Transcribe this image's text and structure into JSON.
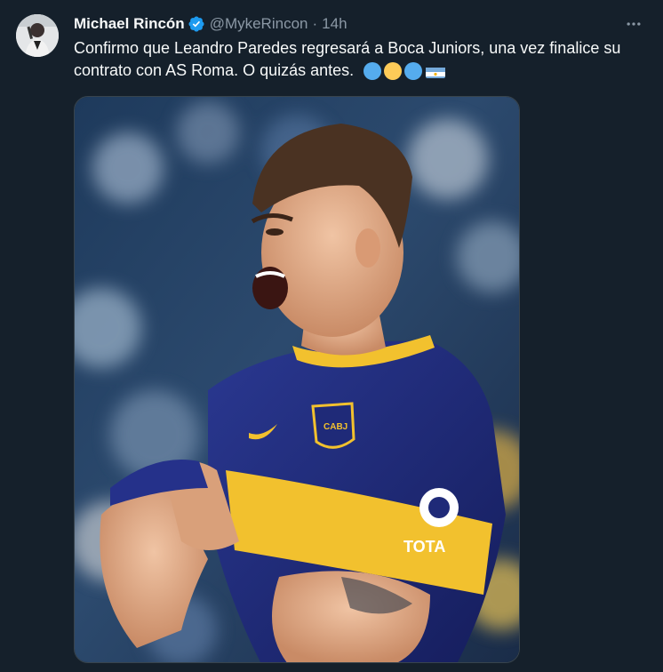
{
  "tweet": {
    "author": {
      "name": "Michael Rincón",
      "handle": "@MykeRincon",
      "verified": true,
      "avatar_icon": "profile-photo"
    },
    "separator": "·",
    "time": "14h",
    "more_icon": "more-horizontal-icon",
    "text": "Confirmo que Leandro Paredes regresará a Boca Juniors, una vez finalice su contrato con AS Roma. O quizás antes.",
    "emojis": [
      {
        "type": "circle",
        "color": "#55acee"
      },
      {
        "type": "circle",
        "color": "#fdcb58"
      },
      {
        "type": "circle",
        "color": "#55acee"
      },
      {
        "type": "flag",
        "name": "argentina-flag"
      }
    ],
    "media": {
      "type": "photo",
      "sponsor_logo_text": "TOTA",
      "crest_text": "CABJ"
    }
  },
  "colors": {
    "background": "#15202b",
    "text_primary": "#f7f9f9",
    "text_secondary": "#8b98a5",
    "verified_blue": "#1d9bf0",
    "boca_blue": "#1f2a78",
    "boca_gold": "#f2c12e"
  }
}
